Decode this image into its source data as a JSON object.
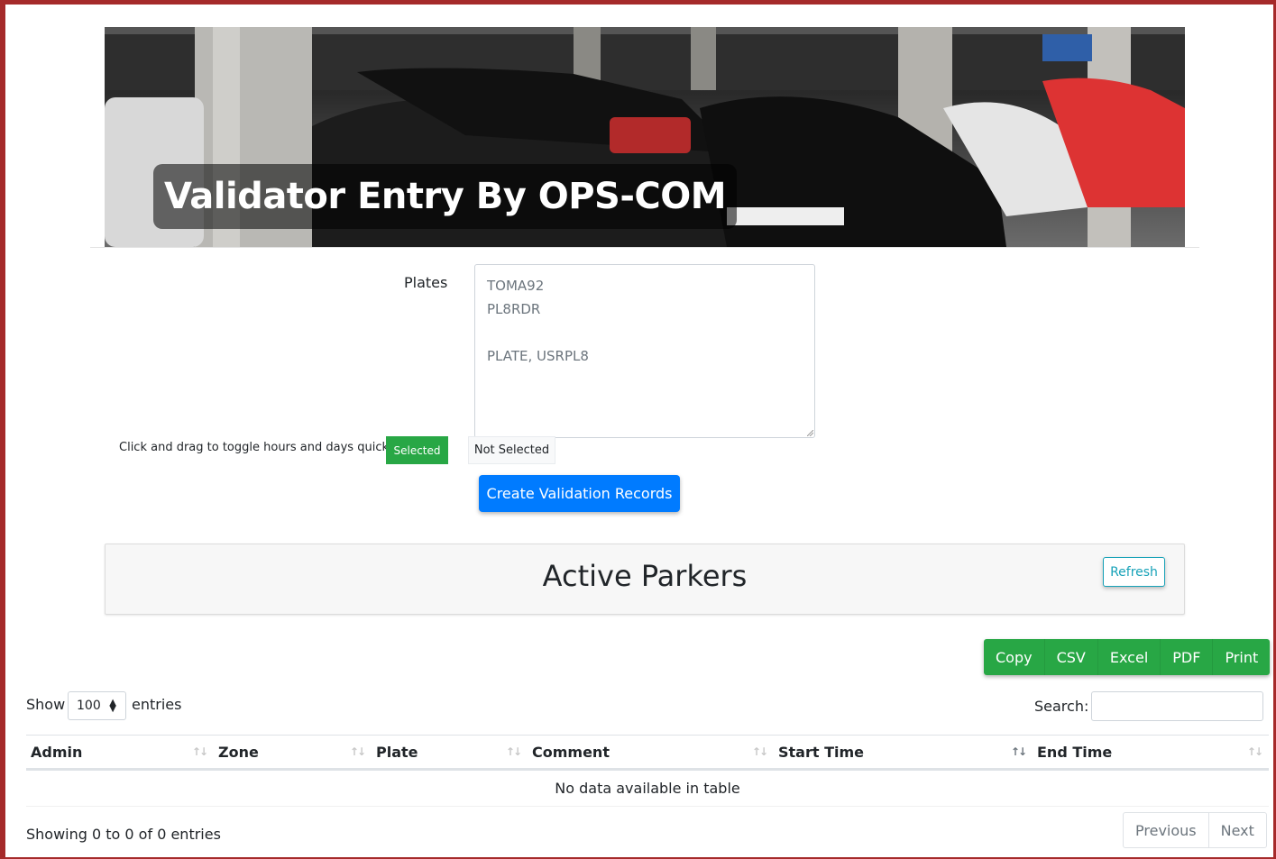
{
  "banner": {
    "title": "Validator Entry By OPS-COM"
  },
  "form": {
    "plates_label": "Plates",
    "plates_value": "TOMA92\nPL8RDR\n\nPLATE, USRPL8",
    "drag_hint": "Click and drag to toggle hours and days quickly.",
    "legend_selected": "Selected",
    "legend_not_selected": "Not Selected",
    "create_button": "Create Validation Records"
  },
  "active_parkers": {
    "title": "Active Parkers",
    "refresh_button": "Refresh"
  },
  "export": {
    "buttons": [
      "Copy",
      "CSV",
      "Excel",
      "PDF",
      "Print"
    ]
  },
  "table_controls": {
    "show_label": "Show",
    "entries_value": "100",
    "entries_label": "entries",
    "search_label": "Search:"
  },
  "table": {
    "columns": [
      "Admin",
      "Zone",
      "Plate",
      "Comment",
      "Start Time",
      "End Time"
    ],
    "empty_message": "No data available in table",
    "info": "Showing 0 to 0 of 0 entries"
  },
  "pagination": {
    "previous": "Previous",
    "next": "Next"
  },
  "colors": {
    "frame": "#a52a2a",
    "primary": "#007bff",
    "success": "#28a745",
    "info": "#17a2b8"
  }
}
